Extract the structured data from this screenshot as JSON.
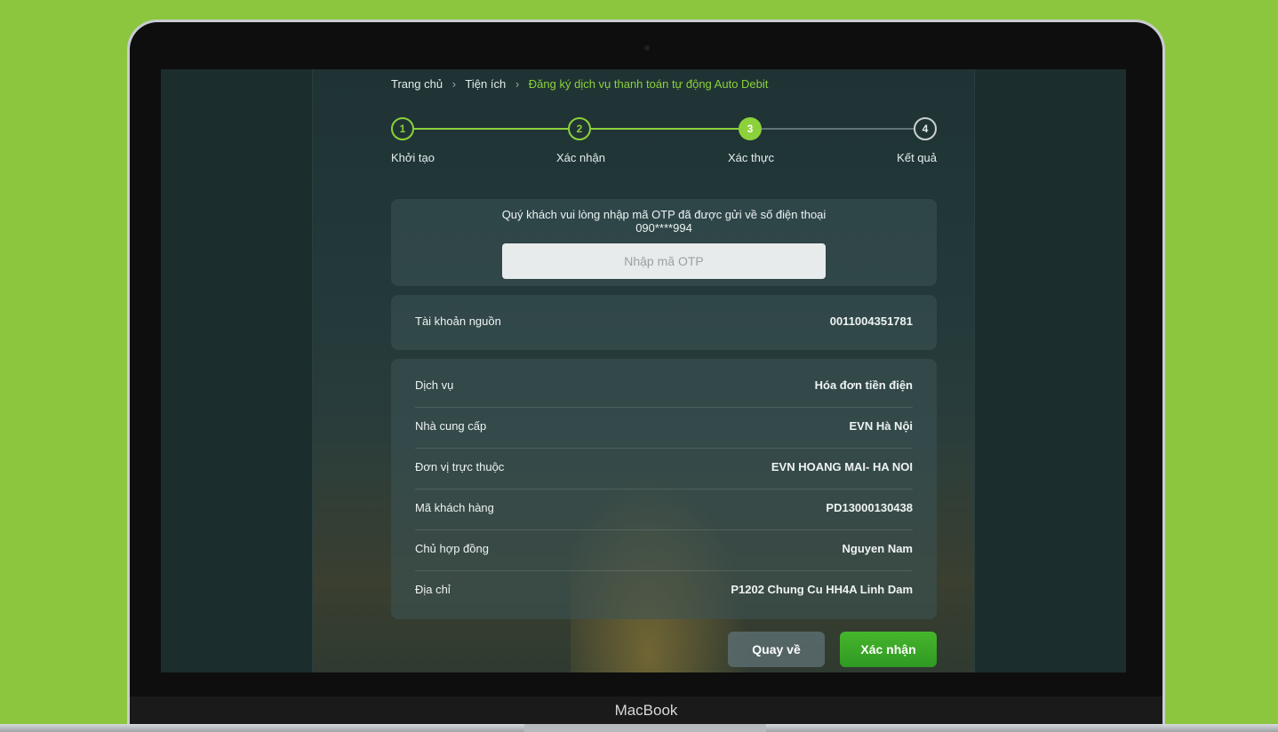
{
  "device": {
    "label": "MacBook"
  },
  "breadcrumb": {
    "items": [
      "Trang chủ",
      "Tiện ích"
    ],
    "current": "Đăng ký dịch vụ thanh toán tự động Auto Debit",
    "separator": "›"
  },
  "stepper": {
    "active_color": "#8cd13b",
    "steps": [
      {
        "number": "1",
        "label": "Khởi tạo",
        "state": "done"
      },
      {
        "number": "2",
        "label": "Xác nhận",
        "state": "done"
      },
      {
        "number": "3",
        "label": "Xác thực",
        "state": "current"
      },
      {
        "number": "4",
        "label": "Kết quả",
        "state": "pending"
      }
    ]
  },
  "otp": {
    "message_line1": "Quý khách vui lòng nhập mã OTP đã được gửi về số điện thoại",
    "message_line2": "090****994",
    "placeholder": "Nhập mã OTP",
    "value": ""
  },
  "account": {
    "label": "Tài khoản nguồn",
    "value": "0011004351781"
  },
  "details": [
    {
      "label": "Dịch vụ",
      "value": "Hóa đơn tiền điện"
    },
    {
      "label": "Nhà cung cấp",
      "value": "EVN Hà Nội"
    },
    {
      "label": "Đơn vị trực thuộc",
      "value": "EVN HOANG MAI- HA NOI"
    },
    {
      "label": "Mã khách hàng",
      "value": "PD13000130438"
    },
    {
      "label": "Chủ hợp đồng",
      "value": "Nguyen Nam"
    },
    {
      "label": "Địa chỉ",
      "value": "P1202 Chung Cu HH4A Linh Dam"
    }
  ],
  "buttons": {
    "back": "Quay về",
    "confirm": "Xác nhận"
  }
}
